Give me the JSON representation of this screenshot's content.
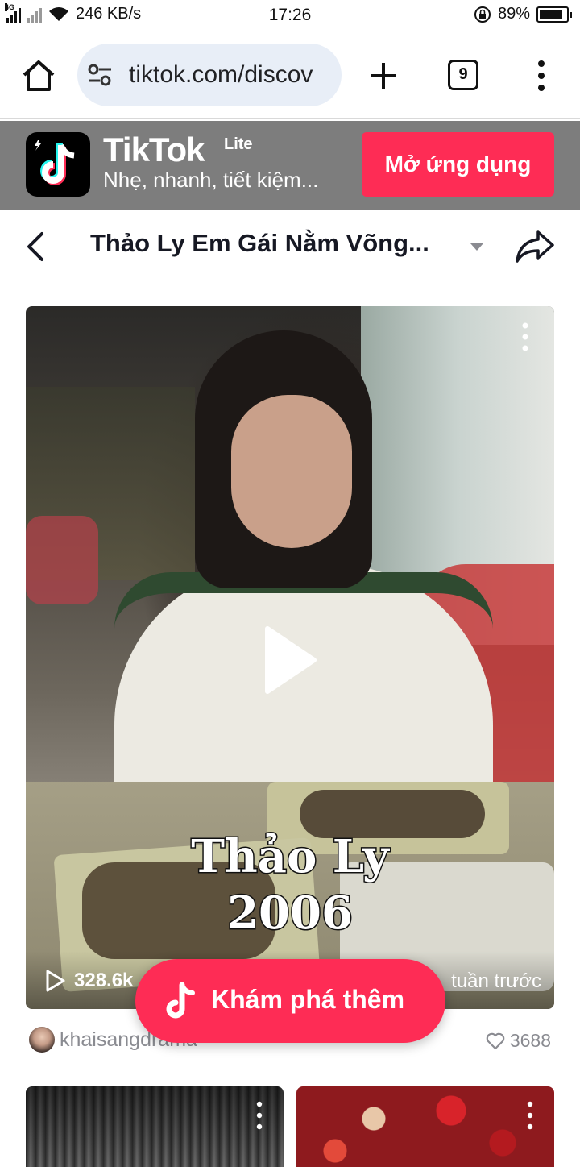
{
  "status_bar": {
    "network_tag": "4G",
    "speed": "246 KB/s",
    "time": "17:26",
    "battery_percent": "89%",
    "battery_level": 0.89
  },
  "browser": {
    "url": "tiktok.com/discov",
    "tab_count": "9",
    "icons": [
      "home-icon",
      "site-settings-icon",
      "new-tab-icon",
      "tabs-icon",
      "more-vert-icon"
    ]
  },
  "banner": {
    "app_name": "TikTok",
    "app_variant": "Lite",
    "tagline": "Nhẹ, nhanh, tiết kiệm...",
    "open_button": "Mở ứng dụng",
    "accent_color": "#fe2c55"
  },
  "header": {
    "title": "Thảo Ly Em Gái Nằm Võng..."
  },
  "video": {
    "overlay_line1": "Thảo Ly",
    "overlay_line2": "2006",
    "views": "328.6k",
    "time_ago": "tuần trước",
    "author": "khaisangdrama",
    "likes": "3688"
  },
  "explore_button": {
    "label": "Khám phá thêm"
  }
}
